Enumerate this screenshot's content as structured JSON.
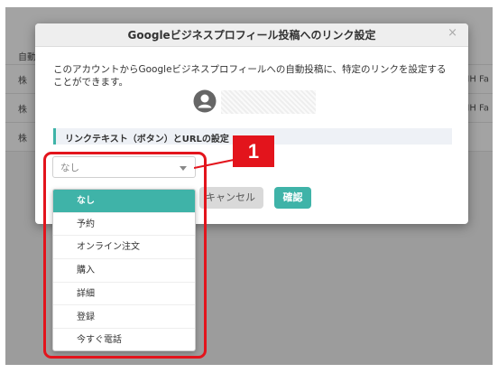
{
  "background": {
    "header_cell": "自動",
    "rows": [
      {
        "left": "株",
        "right": "IH Fa"
      },
      {
        "left": "株",
        "right": "IH Fa"
      },
      {
        "left": "株",
        "right": ""
      }
    ]
  },
  "modal": {
    "title": "Googleビジネスプロフィール投稿へのリンク設定",
    "close": "×",
    "description": "このアカウントからGoogleビジネスプロフィールへの自動投稿に、特定のリンクを設定することができます。",
    "section_title": "リンクテキスト（ボタン）とURLの設定",
    "select_value": "なし",
    "cancel_label": "キャンセル",
    "confirm_label": "確認"
  },
  "dropdown": {
    "options": [
      "なし",
      "予約",
      "オンライン注文",
      "購入",
      "詳細",
      "登録",
      "今すぐ電話"
    ],
    "selected_index": 0
  },
  "annotation": {
    "badge": "1"
  },
  "colors": {
    "accent": "#3fb3a8",
    "annotation_red": "#e3141c"
  }
}
